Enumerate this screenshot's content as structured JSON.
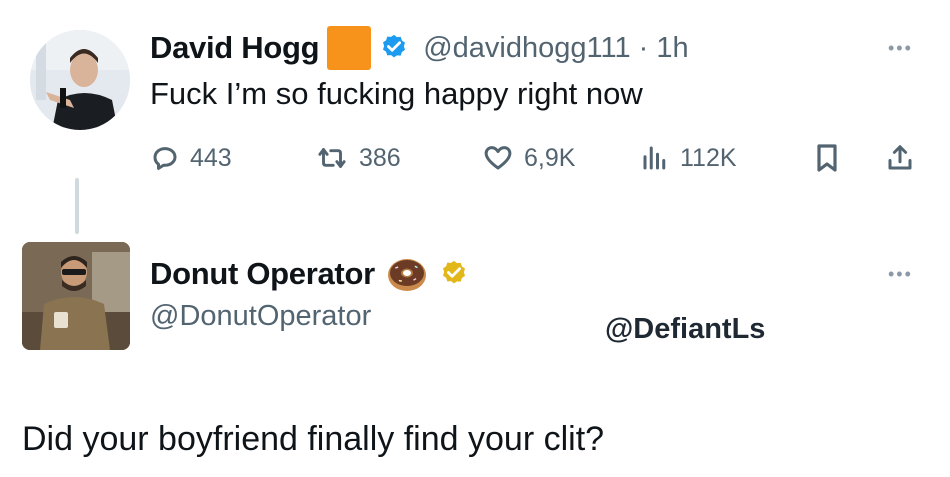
{
  "tweet": {
    "author_name": "David Hogg",
    "handle_time": "@davidhogg111 · 1h",
    "text": "Fuck I’m so fucking happy right now",
    "more_glyph": "•••",
    "stats": {
      "replies": "443",
      "retweets": "386",
      "likes": "6,9K",
      "views": "112K"
    }
  },
  "reply": {
    "author_name": "Donut Operator",
    "handle": "@DonutOperator",
    "more_glyph": "•••",
    "text": "Did your boyfriend finally find your clit?"
  },
  "watermark": "@DefiantLs",
  "colors": {
    "verified_blue": "#1d9bf0",
    "verified_gold": "#e2b719",
    "secondary_text": "#536471",
    "orange_badge": "#f7931a"
  }
}
